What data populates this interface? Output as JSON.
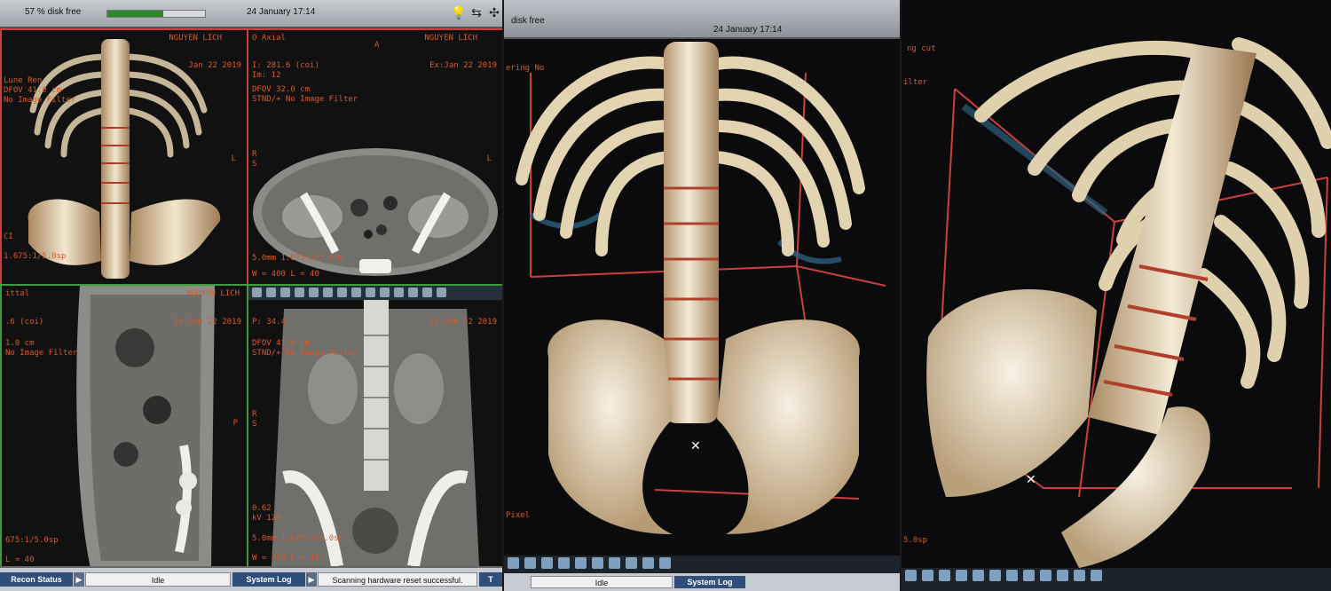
{
  "panel1": {
    "topbar": {
      "disk_free": "57 % disk free",
      "datetime": "24 January 17:14",
      "disk_fill_fraction": 0.57
    },
    "viewports": {
      "vr": {
        "patient": "NGUYEN LICH",
        "exam": "Jan 22 2019",
        "line1": "Lune Ren",
        "line2": "DFOV 41.0 cm",
        "line3": "No Image Filter",
        "line4": "1.675:1/5.0sp",
        "orient_right": "L",
        "orient_left": "CI"
      },
      "axial": {
        "patient": "NGUYEN LICH",
        "title": "O Axial",
        "exam": "Ex:Jan 22 2019",
        "line1": "I: 281.6 (coi)",
        "line2": "Im: 12",
        "line3": "DFOV 32.0 cm",
        "line4": "STND/+ No Image Filter",
        "orient_top": "A",
        "orient_r": "R",
        "orient_s": "S",
        "orient_l": "L",
        "bottom1": "5.0mm 1.675:1/5.0sp",
        "bottom2": "W = 400 L = 40"
      },
      "sagittal": {
        "patient": "NGUYEN LICH",
        "title": "ittal",
        "exam": "Ex:Jan 22 2019",
        "line1": ".6 (coi)",
        "line2": "1.0 cm",
        "line3": "No Image Filter",
        "orient_p": "P",
        "bottom1": "675:1/5.0sp",
        "bottom2": "L = 40"
      },
      "coronal": {
        "exam": "Ex:Jan 22 2019",
        "line1": "P: 34.4",
        "line2": "DFOV 41.0 cm",
        "line3": "STND/+ No Image Filter",
        "orient_r": "R",
        "orient_s": "S",
        "bottom0": "0.62",
        "bottom1": "kV 120",
        "bottom2": "5.0mm 1.675:1/5.0sp",
        "bottom3": "W = 400 L = 40"
      }
    },
    "statusbar": {
      "recon_status": "Recon Status",
      "idle": "Idle",
      "system_log": "System Log",
      "message": "Scanning hardware reset successful."
    }
  },
  "panel2": {
    "topbar": {
      "disk_free": "disk free",
      "datetime": "24 January 17:14"
    },
    "side_text": "ering No",
    "bottom_label": "Pixel",
    "statusbar": {
      "idle": "Idle",
      "system_log": "System Log"
    }
  },
  "panel3": {
    "side_text1": "ng cut",
    "side_text2": "ilter",
    "bottom_label": "5.0sp"
  },
  "colors": {
    "accent_red": "#c9403d",
    "annotation_orange": "#d75a2c",
    "bone": "#e9dcc2",
    "status_blue": "#2f4f7a"
  }
}
